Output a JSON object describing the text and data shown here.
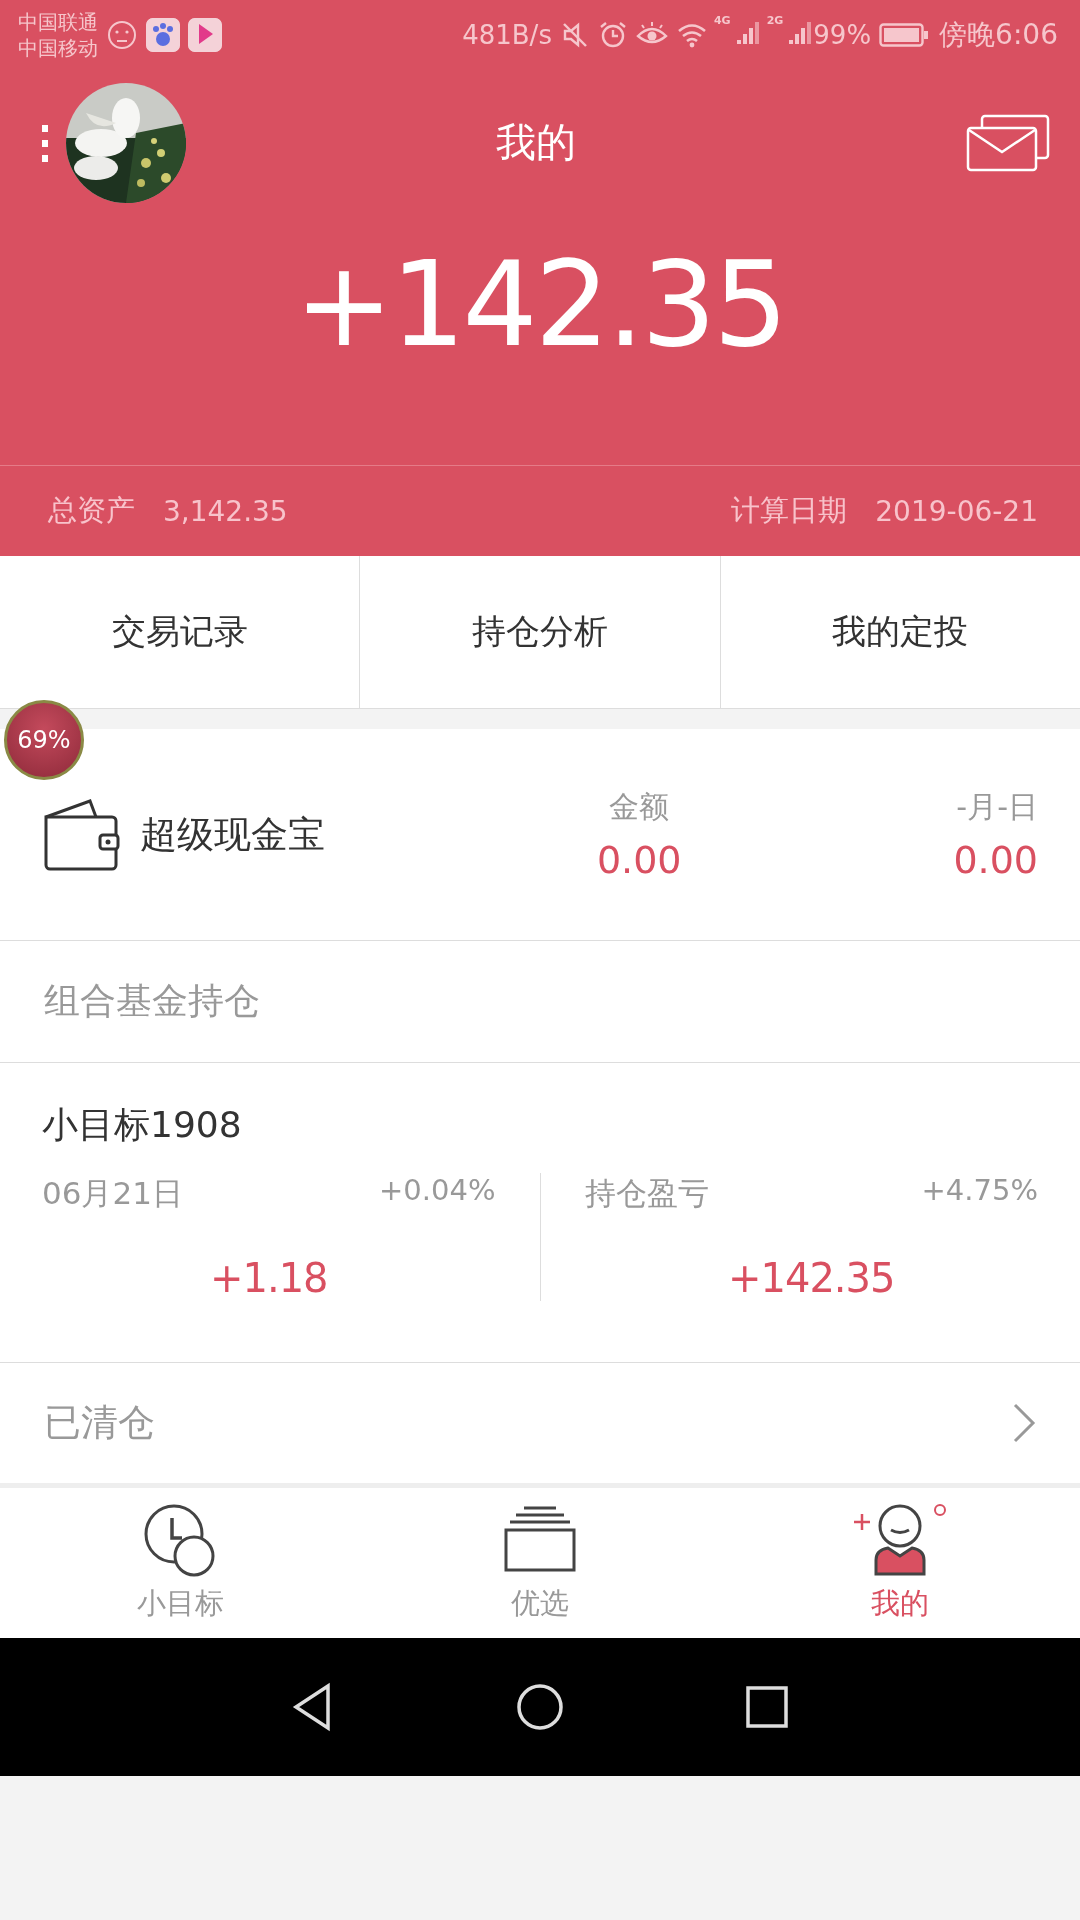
{
  "status_bar": {
    "carriers": [
      "中国联通",
      "中国移动"
    ],
    "speed": "481B/s",
    "net1": "4G",
    "net2": "2G",
    "battery": "99%",
    "time": "傍晚6:06"
  },
  "header": {
    "title": "我的"
  },
  "summary": {
    "amount": "+142.35",
    "total_label": "总资产",
    "total_value": "3,142.35",
    "date_label": "计算日期",
    "date_value": "2019-06-21"
  },
  "float_badge": {
    "text": "69%"
  },
  "actions": [
    "交易记录",
    "持仓分析",
    "我的定投"
  ],
  "cash": {
    "name": "超级现金宝",
    "amount_label": "金额",
    "amount": "0.00",
    "date_label": "-月-日",
    "date_amount": "0.00"
  },
  "section_title": "组合基金持仓",
  "fund": {
    "name": "小目标1908",
    "day_label": "06月21日",
    "day_pct": "+0.04%",
    "day_value": "+1.18",
    "hold_label": "持仓盈亏",
    "hold_pct": "+4.75%",
    "hold_value": "+142.35"
  },
  "cleared": {
    "label": "已清仓"
  },
  "nav": [
    {
      "label": "小目标",
      "kind": "clock",
      "selected": false
    },
    {
      "label": "优选",
      "kind": "stack",
      "selected": false
    },
    {
      "label": "我的",
      "kind": "person",
      "selected": true
    }
  ]
}
